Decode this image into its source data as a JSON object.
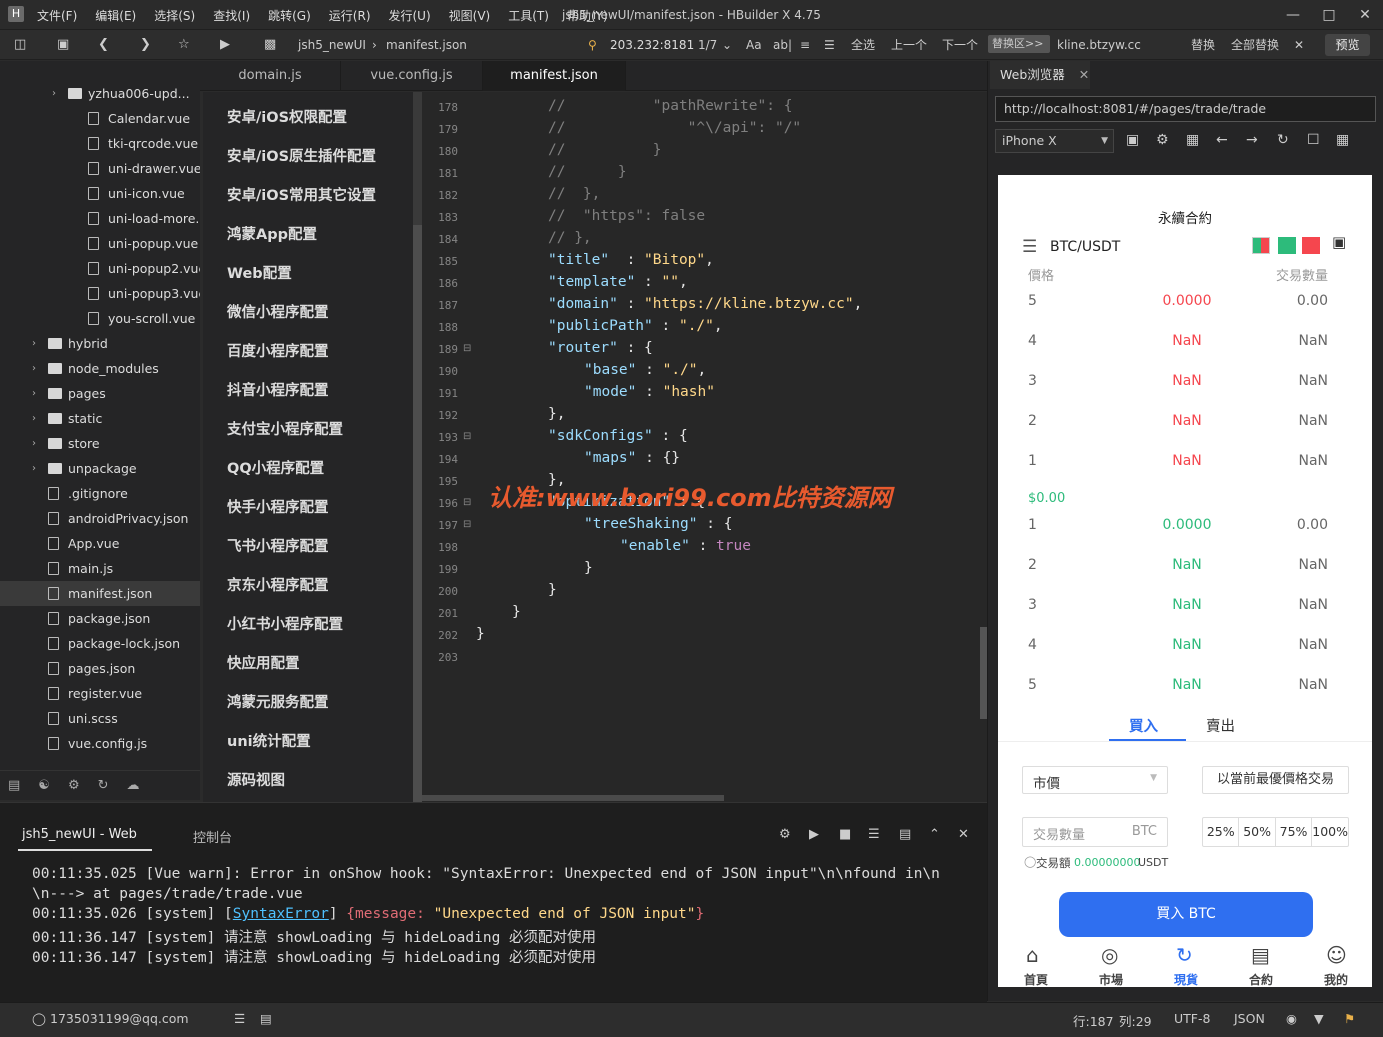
{
  "window": {
    "title": "jsh5_newUI/manifest.json - HBuilder X 4.75",
    "app_icon": "H",
    "menu": [
      "文件(F)",
      "编辑(E)",
      "选择(S)",
      "查找(I)",
      "跳转(G)",
      "运行(R)",
      "发行(U)",
      "视图(V)",
      "工具(T)",
      "帮助(Y)"
    ]
  },
  "toolbar": {
    "project": "jsh5_newUI",
    "file": "manifest.json",
    "search_value": "203.232:8181",
    "search_count": "1/7",
    "search_opts": [
      "Aa",
      "ab|",
      "全选",
      "上一个",
      "下一个"
    ],
    "replace_box": "替换区>>",
    "replace_value": "kline.btzyw.cc",
    "replace_btn": "替换",
    "replace_all_btn": "全部替换",
    "preview_btn": "预览"
  },
  "tree": {
    "items": [
      {
        "label": "yzhua006-upd...",
        "type": "folder",
        "arrow": "›",
        "level": 2
      },
      {
        "label": "Calendar.vue",
        "type": "file",
        "level": 3
      },
      {
        "label": "tki-qrcode.vue",
        "type": "file",
        "level": 3
      },
      {
        "label": "uni-drawer.vue",
        "type": "file",
        "level": 3
      },
      {
        "label": "uni-icon.vue",
        "type": "file",
        "level": 3
      },
      {
        "label": "uni-load-more...",
        "type": "file",
        "level": 3
      },
      {
        "label": "uni-popup.vue",
        "type": "file",
        "level": 3
      },
      {
        "label": "uni-popup2.vue",
        "type": "file",
        "level": 3
      },
      {
        "label": "uni-popup3.vue",
        "type": "file",
        "level": 3
      },
      {
        "label": "you-scroll.vue",
        "type": "file",
        "level": 3
      },
      {
        "label": "hybrid",
        "type": "folder",
        "arrow": "›",
        "level": 1
      },
      {
        "label": "node_modules",
        "type": "folder",
        "arrow": "›",
        "level": 1
      },
      {
        "label": "pages",
        "type": "folder",
        "arrow": "›",
        "level": 1
      },
      {
        "label": "static",
        "type": "folder",
        "arrow": "›",
        "level": 1
      },
      {
        "label": "store",
        "type": "folder",
        "arrow": "›",
        "level": 1
      },
      {
        "label": "unpackage",
        "type": "folder",
        "arrow": "›",
        "level": 1
      },
      {
        "label": ".gitignore",
        "type": "file",
        "level": 1
      },
      {
        "label": "androidPrivacy.json",
        "type": "file",
        "level": 1
      },
      {
        "label": "App.vue",
        "type": "file",
        "level": 1
      },
      {
        "label": "main.js",
        "type": "file",
        "level": 1
      },
      {
        "label": "manifest.json",
        "type": "file",
        "level": 1,
        "selected": true
      },
      {
        "label": "package.json",
        "type": "file",
        "level": 1
      },
      {
        "label": "package-lock.json",
        "type": "file",
        "level": 1
      },
      {
        "label": "pages.json",
        "type": "file",
        "level": 1
      },
      {
        "label": "register.vue",
        "type": "file",
        "level": 1
      },
      {
        "label": "uni.scss",
        "type": "file",
        "level": 1
      },
      {
        "label": "vue.config.js",
        "type": "file",
        "level": 1
      }
    ]
  },
  "tabs": [
    "domain.js",
    "vue.config.js",
    "manifest.json"
  ],
  "config_menu": [
    "安卓/iOS权限配置",
    "安卓/iOS原生插件配置",
    "安卓/iOS常用其它设置",
    "鸿蒙App配置",
    "Web配置",
    "微信小程序配置",
    "百度小程序配置",
    "抖音小程序配置",
    "支付宝小程序配置",
    "QQ小程序配置",
    "快手小程序配置",
    "飞书小程序配置",
    "京东小程序配置",
    "小红书小程序配置",
    "快应用配置",
    "鸿蒙元服务配置",
    "uni统计配置",
    "源码视图"
  ],
  "code": {
    "lines": [
      {
        "n": "178",
        "fold": "",
        "t": [
          [
            "c-cm",
            "//          \"pathRewrite\": {"
          ]
        ],
        "indent": 2
      },
      {
        "n": "179",
        "fold": "",
        "t": [
          [
            "c-cm",
            "//              \"^\\/api\": \"/\""
          ]
        ],
        "indent": 2
      },
      {
        "n": "180",
        "fold": "",
        "t": [
          [
            "c-cm",
            "//          }"
          ]
        ],
        "indent": 2
      },
      {
        "n": "181",
        "fold": "",
        "t": [
          [
            "c-cm",
            "//      }"
          ]
        ],
        "indent": 2
      },
      {
        "n": "182",
        "fold": "",
        "t": [
          [
            "c-cm",
            "//  },"
          ]
        ],
        "indent": 2
      },
      {
        "n": "183",
        "fold": "",
        "t": [
          [
            "c-cm",
            "//  \"https\": false"
          ]
        ],
        "indent": 2
      },
      {
        "n": "184",
        "fold": "",
        "t": [
          [
            "c-cm",
            "// },"
          ]
        ],
        "indent": 2
      },
      {
        "n": "185",
        "fold": "",
        "t": [
          [
            "c-k",
            "\"title\""
          ],
          [
            "",
            "  : "
          ],
          [
            "c-s",
            "\"Bitop\""
          ],
          [
            "",
            ","
          ]
        ],
        "indent": 2
      },
      {
        "n": "186",
        "fold": "",
        "t": [
          [
            "c-k",
            "\"template\""
          ],
          [
            "",
            " : "
          ],
          [
            "c-s",
            "\"\""
          ],
          [
            "",
            ","
          ]
        ],
        "indent": 2
      },
      {
        "n": "187",
        "fold": "",
        "t": [
          [
            "c-k",
            "\"domain\""
          ],
          [
            "",
            " : "
          ],
          [
            "c-s",
            "\"https://kline.btzyw.cc\""
          ],
          [
            "",
            ","
          ]
        ],
        "indent": 2
      },
      {
        "n": "188",
        "fold": "",
        "t": [
          [
            "c-k",
            "\"publicPath\""
          ],
          [
            "",
            " : "
          ],
          [
            "c-s",
            "\"./\""
          ],
          [
            "",
            ","
          ]
        ],
        "indent": 2
      },
      {
        "n": "189",
        "fold": "⊟",
        "t": [
          [
            "c-k",
            "\"router\""
          ],
          [
            "",
            " : {"
          ]
        ],
        "indent": 2
      },
      {
        "n": "190",
        "fold": "",
        "t": [
          [
            "c-k",
            "\"base\""
          ],
          [
            "",
            " : "
          ],
          [
            "c-s",
            "\"./\""
          ],
          [
            "",
            ","
          ]
        ],
        "indent": 3
      },
      {
        "n": "191",
        "fold": "",
        "t": [
          [
            "c-k",
            "\"mode\""
          ],
          [
            "",
            " : "
          ],
          [
            "c-s",
            "\"hash\""
          ]
        ],
        "indent": 3
      },
      {
        "n": "192",
        "fold": "",
        "t": [
          [
            "",
            "},"
          ]
        ],
        "indent": 2
      },
      {
        "n": "193",
        "fold": "⊟",
        "t": [
          [
            "c-k",
            "\"sdkConfigs\""
          ],
          [
            "",
            " : {"
          ]
        ],
        "indent": 2
      },
      {
        "n": "194",
        "fold": "",
        "t": [
          [
            "c-k",
            "\"maps\""
          ],
          [
            "",
            " : {}"
          ]
        ],
        "indent": 3
      },
      {
        "n": "195",
        "fold": "",
        "t": [
          [
            "",
            "},"
          ]
        ],
        "indent": 2
      },
      {
        "n": "196",
        "fold": "⊟",
        "t": [
          [
            "c-k",
            "\"optimization\""
          ],
          [
            "",
            " : {"
          ]
        ],
        "indent": 2
      },
      {
        "n": "197",
        "fold": "⊟",
        "t": [
          [
            "c-k",
            "\"treeShaking\""
          ],
          [
            "",
            " : {"
          ]
        ],
        "indent": 3
      },
      {
        "n": "198",
        "fold": "",
        "t": [
          [
            "c-k",
            "\"enable\""
          ],
          [
            "",
            " : "
          ],
          [
            "c-b",
            "true"
          ]
        ],
        "indent": 4
      },
      {
        "n": "199",
        "fold": "",
        "t": [
          [
            "",
            "}"
          ]
        ],
        "indent": 3
      },
      {
        "n": "200",
        "fold": "",
        "t": [
          [
            "",
            "}"
          ]
        ],
        "indent": 2
      },
      {
        "n": "201",
        "fold": "",
        "t": [
          [
            "",
            "}"
          ]
        ],
        "indent": 1
      },
      {
        "n": "202",
        "fold": "",
        "t": [
          [
            "",
            "}"
          ]
        ],
        "indent": 0
      },
      {
        "n": "203",
        "fold": "",
        "t": [],
        "indent": 0
      }
    ],
    "watermark": "认准:www.bori99.com比特资源网"
  },
  "browser": {
    "tab_label": "Web浏览器",
    "url": "http://localhost:8081/#/pages/trade/trade",
    "device": "iPhone X",
    "phone": {
      "page_title": "永續合約",
      "pair": "BTC/USDT",
      "col_price": "價格",
      "col_qty": "交易數量",
      "asks": [
        {
          "i": "5",
          "p": "0.0000",
          "q": "0.00"
        },
        {
          "i": "4",
          "p": "NaN",
          "q": "NaN"
        },
        {
          "i": "3",
          "p": "NaN",
          "q": "NaN"
        },
        {
          "i": "2",
          "p": "NaN",
          "q": "NaN"
        },
        {
          "i": "1",
          "p": "NaN",
          "q": "NaN"
        }
      ],
      "mid_price": "$0.00",
      "bids": [
        {
          "i": "1",
          "p": "0.0000",
          "q": "0.00"
        },
        {
          "i": "2",
          "p": "NaN",
          "q": "NaN"
        },
        {
          "i": "3",
          "p": "NaN",
          "q": "NaN"
        },
        {
          "i": "4",
          "p": "NaN",
          "q": "NaN"
        },
        {
          "i": "5",
          "p": "NaN",
          "q": "NaN"
        }
      ],
      "tab_buy": "買入",
      "tab_sell": "賣出",
      "order_type": "市價",
      "best_price_btn": "以當前最優價格交易",
      "qty_placeholder": "交易數量",
      "qty_unit": "BTC",
      "pct": [
        "25%",
        "50%",
        "75%",
        "100%"
      ],
      "amount_label": "交易額",
      "amount_value": "0.00000000",
      "amount_unit": "USDT",
      "buy_btn": "買入 BTC",
      "nav": [
        "首頁",
        "市場",
        "現貨",
        "合約",
        "我的"
      ],
      "colors": {
        "red": "#f5464e",
        "green": "#2dbb7b",
        "blue": "#2f6ff0"
      }
    }
  },
  "console": {
    "tab1": "jsh5_newUI - Web",
    "tab2": "控制台",
    "lines": [
      [
        [
          "",
          "00:11:35.025 [Vue warn]: Error in onShow hook: \"SyntaxError: Unexpected end of JSON input\"\\n\\nfound in\\n"
        ]
      ],
      [
        [
          "",
          "\\n---> at pages/trade/trade.vue"
        ]
      ],
      [
        [
          "",
          "00:11:35.026 [system] ["
        ],
        [
          "link",
          "SyntaxError"
        ],
        [
          "",
          "] "
        ],
        [
          "obj",
          "{message: "
        ],
        [
          "str",
          "\"Unexpected end of JSON input\""
        ],
        [
          "obj",
          "}"
        ]
      ],
      [
        [
          "",
          "00:11:36.147 [system] 请注意 showLoading 与 hideLoading 必须配对使用"
        ]
      ],
      [
        [
          "",
          "00:11:36.147 [system] 请注意 showLoading 与 hideLoading 必须配对使用"
        ]
      ]
    ]
  },
  "statusbar": {
    "user": "1735031199@qq.com",
    "row": "行:187",
    "col": "列:29",
    "encoding": "UTF-8",
    "lang": "JSON"
  }
}
